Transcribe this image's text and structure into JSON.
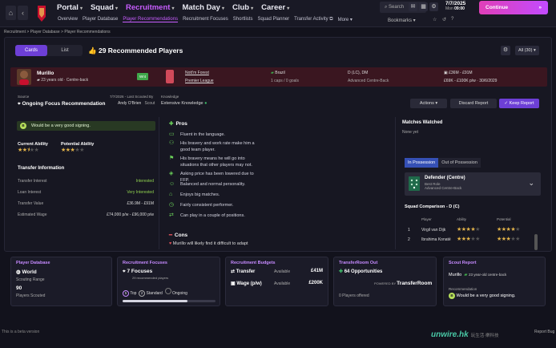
{
  "topbar": {
    "main_nav": [
      "Portal",
      "Squad",
      "Recruitment",
      "Match Day",
      "Club",
      "Career"
    ],
    "sub_nav": [
      "Overview",
      "Player Database",
      "Player Recommendations",
      "Recruitment Focuses",
      "Shortlists",
      "Squad Planner",
      "Transfer Activity",
      "More"
    ],
    "search": "Search",
    "date": "7/7/2025",
    "day": "Mon",
    "time": "09:00",
    "continue": "Continue",
    "bookmarks": "Bookmarks"
  },
  "breadcrumb": "Recruitment > Player Database > Player Recommendations",
  "main": {
    "view_cards": "Cards",
    "view_list": "List",
    "title": "29 Recommended Players",
    "filter": "All (30)"
  },
  "player": {
    "name": "Murillo",
    "info": "23 years old · Centre-back",
    "tag": "Wnt",
    "club": "Nott'm Forest",
    "league": "Premier League",
    "nation": "Brazil",
    "caps": "1 caps / 0 goals",
    "positions": "D (LC), DM",
    "role": "Advanced Centre-Back",
    "value": "£36M - £91M",
    "wage": "£69K - £100K p/w · 30/6/2029"
  },
  "recommendation": {
    "source_label": "Source",
    "source": "Ongoing Focus Recommendation",
    "scout_label": "7/7/2026 - Last Scouted By",
    "scout_name": "Andy O'Brien",
    "scout_role": "Scout",
    "knowledge_label": "Knowledge",
    "knowledge": "Extensive Knowledge",
    "verdict": "Would be a very good signing.",
    "current_ability": "Current Ability",
    "potential_ability": "Potential Ability",
    "actions": "Actions",
    "discard": "Discard Report",
    "keep": "Keep Report"
  },
  "transfer_info": {
    "title": "Transfer Information",
    "rows": [
      {
        "label": "Transfer Interest",
        "value": "Interested"
      },
      {
        "label": "Loan Interest",
        "value": "Very Interested"
      },
      {
        "label": "Transfer Value",
        "value": "£36.9M - £91M"
      },
      {
        "label": "Estimated Wage",
        "value": "£74,000 p/w - £96,000 p/w"
      }
    ]
  },
  "pros": {
    "title": "Pros",
    "items": [
      "Fluent in the language.",
      "His bravery and work rate make him a good team player.",
      "His bravery means he will go into situations that other players may not.",
      "Asking price has been lowered due to FFP.",
      "Balanced and normal personality.",
      "Enjoys big matches.",
      "Fairly consistent performer.",
      "Can play in a couple of positions."
    ]
  },
  "cons": {
    "title": "Cons",
    "items": [
      "Murillo will likely find it difficult to adapt"
    ]
  },
  "matches": {
    "title": "Matches Watched",
    "value": "None yet"
  },
  "possession_tabs": [
    "In Possession",
    "Out of Possession"
  ],
  "role_box": {
    "title": "Defender (Centre)",
    "sub1": "Best Role",
    "sub2": "Advanced Centre-Back"
  },
  "squad_comparison": {
    "title": "Squad Comparison - D (C)",
    "headers": [
      "Player",
      "Ability",
      "Potential"
    ],
    "rows": [
      {
        "n": "1",
        "player": "Virgil van Dijk"
      },
      {
        "n": "2",
        "player": "Ibrahima Konaté"
      }
    ]
  },
  "cards": {
    "database": {
      "title": "Player Database",
      "scope": "World",
      "range_label": "Scouting Range",
      "count": "90",
      "count_label": "Players Scouted"
    },
    "focuses": {
      "title": "Recruitment Focuses",
      "count": "7 Focuses",
      "sub": "29 recommended players",
      "top": "Top",
      "standard": "Standard",
      "ongoing": "Ongoing",
      "n_top": "5",
      "n_standard": "2"
    },
    "budgets": {
      "title": "Recruitment Budgets",
      "transfer_label": "Transfer",
      "transfer_status": "Available",
      "transfer": "£41M",
      "wage_label": "Wage (p/w)",
      "wage_status": "Available",
      "wage": "£200K"
    },
    "transferroom": {
      "title": "TransferRoom Out",
      "opps": "64 Opportunities",
      "powered": "POWERED BY",
      "brand": "TransferRoom",
      "offered": "0 Players offered"
    },
    "scout": {
      "title": "Scout Report",
      "player": "Murillo",
      "info": "23 year-old centre-back",
      "rec_label": "Recommendation",
      "rec": "Would be a very good signing."
    }
  },
  "footer": {
    "left": "This is a beta version",
    "right": "Report Bug",
    "watermark": "unwire.hk",
    "watermark_sub": "玩生活·樂科技"
  }
}
